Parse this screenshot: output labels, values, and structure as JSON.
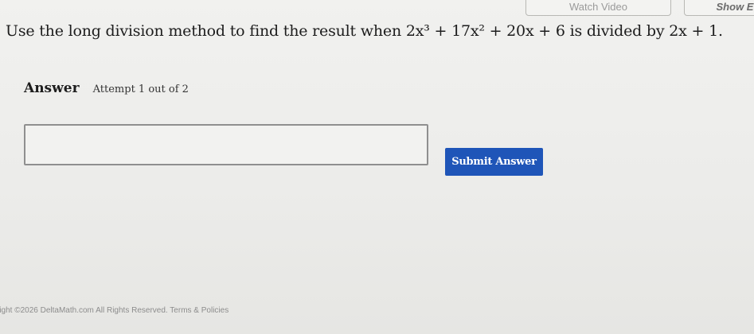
{
  "header": {
    "video_button_label": "Watch Video",
    "show_button_label": "Show E"
  },
  "question": {
    "prefix": "Use the long division method to find the result when",
    "dividend": "2x³ + 17x² + 20x + 6",
    "middle": "is divided by",
    "divisor": "2x + 1."
  },
  "answer": {
    "heading": "Answer",
    "attempt": "Attempt 1 out of 2",
    "input_value": "",
    "submit_label": "Submit Answer"
  },
  "footer": {
    "copyright": "right ©2026 DeltaMath.com All Rights Reserved.",
    "terms_link": "Terms & Policies"
  }
}
